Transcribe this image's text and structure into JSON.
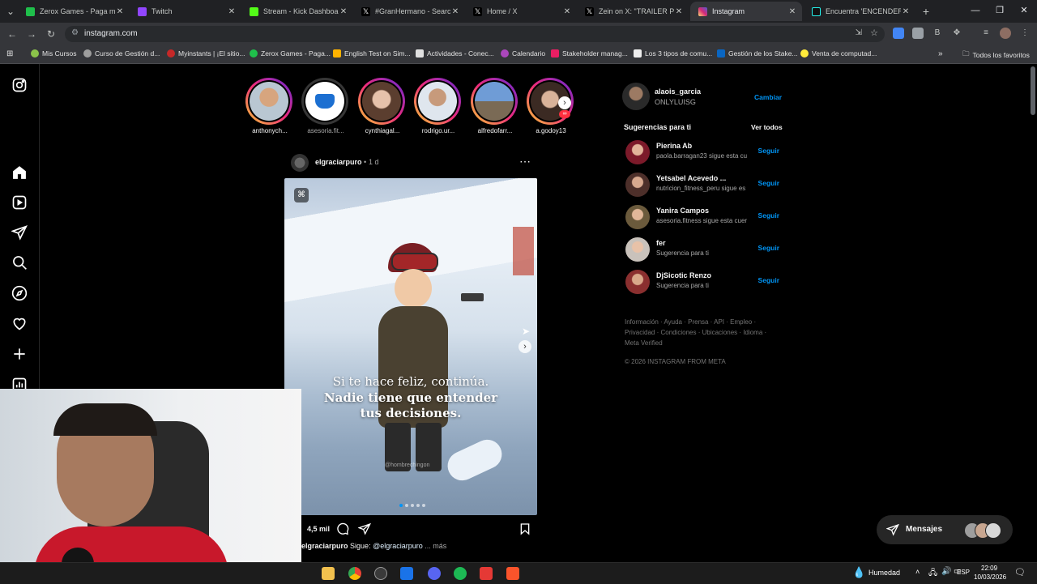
{
  "browser": {
    "tabs": [
      {
        "title": "Zerox Games - Paga men",
        "color": "#1fbf4b"
      },
      {
        "title": "Twitch",
        "color": "#9146ff"
      },
      {
        "title": "Stream - Kick Dashboard",
        "color": "#53fc18"
      },
      {
        "title": "#GranHermano - Search /",
        "color": "#e7e9ea"
      },
      {
        "title": "Home / X",
        "color": "#e7e9ea"
      },
      {
        "title": "Zein on X: \"TRAILER PERU",
        "color": "#e7e9ea"
      },
      {
        "title": "Instagram",
        "color": "#e1306c"
      },
      {
        "title": "Encuentra 'ENCENDER M",
        "color": "#25f4ee"
      }
    ],
    "url": "instagram.com",
    "bookmarks": [
      {
        "label": "Mis Cursos",
        "color": "#8bc34a"
      },
      {
        "label": "Curso de Gestión d...",
        "color": "#9e9e9e"
      },
      {
        "label": "Myinstants | ¡El sitio...",
        "color": "#c62828"
      },
      {
        "label": "Zerox Games - Paga...",
        "color": "#1fbf4b"
      },
      {
        "label": "English Test on Sim...",
        "color": "#ffb300"
      },
      {
        "label": "Actividades - Conec...",
        "color": "#e0e0e0"
      },
      {
        "label": "Calendario",
        "color": "#ab47bc"
      },
      {
        "label": "Stakeholder manag...",
        "color": "#e91e63"
      },
      {
        "label": "Los 3 tipos de comu...",
        "color": "#eeeeee"
      },
      {
        "label": "Gestión de los Stake...",
        "color": "#0a66c2"
      },
      {
        "label": "Venta de computad...",
        "color": "#ffeb3b"
      }
    ],
    "all_favorites": "Todos los favoritos"
  },
  "stories": [
    {
      "name": "anthonych...",
      "seen": false
    },
    {
      "name": "asesoria.fit...",
      "seen": true
    },
    {
      "name": "cynthiagal...",
      "seen": false
    },
    {
      "name": "rodrigo.ur...",
      "seen": false
    },
    {
      "name": "alfredofarr...",
      "seen": false
    },
    {
      "name": "a.godoy13",
      "seen": false
    }
  ],
  "post": {
    "username": "elgraciarpuro",
    "time": "1 d",
    "overlay_line1": "Si te hace feliz, continúa.",
    "overlay_line2": "Nadie tiene que entender",
    "overlay_line3": "tus decisiones.",
    "watermark": "@hombrechingon",
    "likes": "4,5 mil",
    "caption_user": "elgraciarpuro",
    "caption_text": "Sigue:",
    "caption_mention": "@elgraciarpuro",
    "caption_more": "... más"
  },
  "account": {
    "username": "alaois_garcia",
    "name": "ONLYLUISG",
    "switch": "Cambiar"
  },
  "suggestions": {
    "title": "Sugerencias para ti",
    "see_all": "Ver todos",
    "follow": "Seguir",
    "items": [
      {
        "user": "Pierina Ab",
        "sub": "paola.barragan23 sigue esta cu"
      },
      {
        "user": "Yetsabel Acevedo ...",
        "sub": "nutricion_fitness_peru sigue es"
      },
      {
        "user": "Yanira Campos",
        "sub": "asesoria.fitness sigue esta cuer"
      },
      {
        "user": "fer",
        "sub": "Sugerencia para ti"
      },
      {
        "user": "DjSicotic Renzo",
        "sub": "Sugerencia para ti"
      }
    ]
  },
  "footer": {
    "line1": "Información · Ayuda · Prensa · API · Empleo ·",
    "line2": "Privacidad · Condiciones · Ubicaciones · Idioma ·",
    "line3": "Meta Verified",
    "copyright": "© 2026 INSTAGRAM FROM META"
  },
  "messages": {
    "label": "Mensajes"
  },
  "taskbar": {
    "weather": "Humedad",
    "lang": "ESP",
    "time": "22:09",
    "date": "10/03/2026"
  }
}
